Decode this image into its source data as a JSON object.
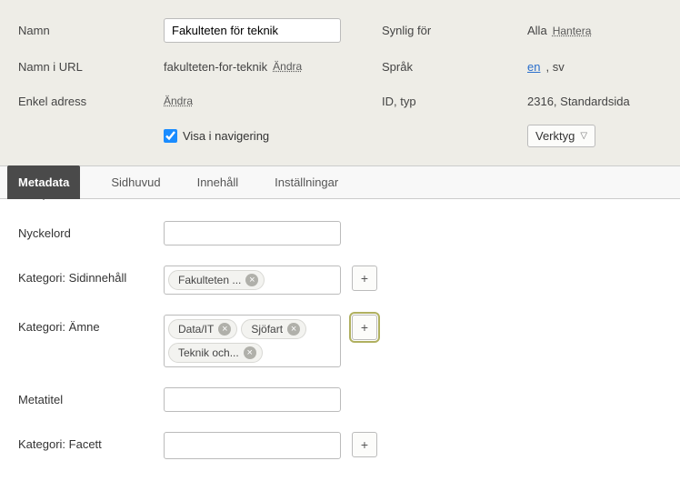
{
  "header": {
    "name_label": "Namn",
    "name_value": "Fakulteten för teknik",
    "url_label": "Namn i URL",
    "url_value": "fakulteten-for-teknik",
    "url_change": "Ändra",
    "simple_address_label": "Enkel adress",
    "simple_address_change": "Ändra",
    "nav_checkbox_label": "Visa i navigering",
    "visible_for_label": "Synlig för",
    "visible_for_value": "Alla",
    "visible_for_manage": "Hantera",
    "language_label": "Språk",
    "language_primary": "en",
    "language_rest": ", sv",
    "idtype_label": "ID, typ",
    "idtype_value": "2316, Standardsida",
    "tools_label": "Verktyg"
  },
  "tabs": [
    {
      "label": "Metadata",
      "active": true
    },
    {
      "label": "Sidhuvud",
      "active": false
    },
    {
      "label": "Innehåll",
      "active": false
    },
    {
      "label": "Inställningar",
      "active": false
    }
  ],
  "content": {
    "keyword_label": "Nyckelord",
    "keyword_value": "",
    "cat_page_label": "Kategori: Sidinnehåll",
    "cat_page_tags": [
      "Fakulteten ..."
    ],
    "cat_subject_label": "Kategori: Ämne",
    "cat_subject_tags": [
      "Data/IT",
      "Sjöfart",
      "Teknik och..."
    ],
    "metatitle_label": "Metatitel",
    "metatitle_value": "",
    "cat_facet_label": "Kategori: Facett",
    "cat_facet_tags": [],
    "add_button": "+"
  }
}
